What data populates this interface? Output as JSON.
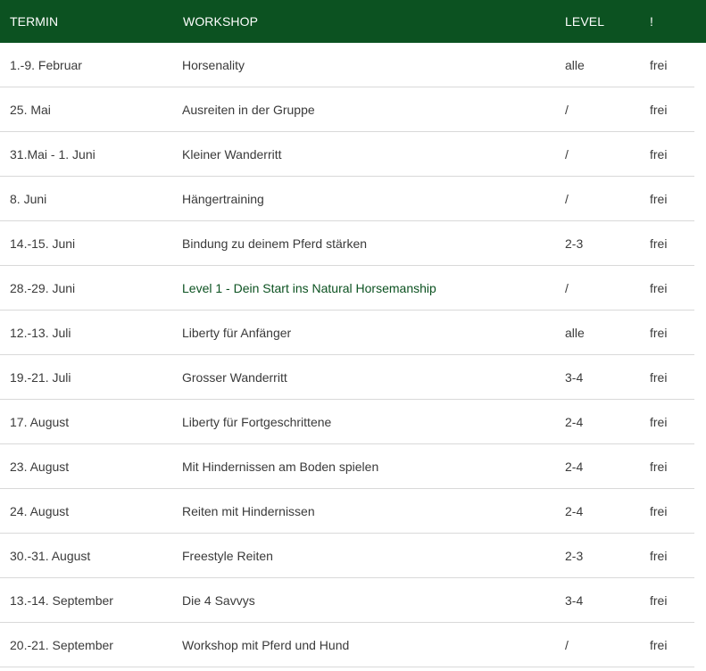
{
  "table": {
    "columns": [
      "TERMIN",
      "WORKSHOP",
      "LEVEL",
      "!"
    ],
    "rows": [
      {
        "termin": "1.-9. Februar",
        "workshop": "Horsenality",
        "level": "alle",
        "status": "frei"
      },
      {
        "termin": "25. Mai",
        "workshop": "Ausreiten in der Gruppe",
        "level": "/",
        "status": "frei"
      },
      {
        "termin": "31.Mai - 1. Juni",
        "workshop": "Kleiner Wanderritt",
        "level": "/",
        "status": "frei"
      },
      {
        "termin": "8. Juni",
        "workshop": "Hängertraining",
        "level": "/",
        "status": "frei"
      },
      {
        "termin": "14.-15. Juni",
        "workshop": "Bindung zu deinem Pferd stärken",
        "level": "2-3",
        "status": "frei"
      },
      {
        "termin": "28.-29. Juni",
        "workshop": "Level 1 - Dein Start ins Natural Horsemanship",
        "level": "/",
        "status": "frei"
      },
      {
        "termin": "12.-13. Juli",
        "workshop": "Liberty für Anfänger",
        "level": "alle",
        "status": "frei"
      },
      {
        "termin": "19.-21. Juli",
        "workshop": "Grosser Wanderritt",
        "level": "3-4",
        "status": "frei"
      },
      {
        "termin": "17. August",
        "workshop": "Liberty für Fortgeschrittene",
        "level": "2-4",
        "status": "frei"
      },
      {
        "termin": "23. August",
        "workshop": "Mit Hindernissen am Boden spielen",
        "level": "2-4",
        "status": "frei"
      },
      {
        "termin": "24. August",
        "workshop": "Reiten mit Hindernissen",
        "level": "2-4",
        "status": "frei"
      },
      {
        "termin": "30.-31. August",
        "workshop": "Freestyle Reiten",
        "level": "2-3",
        "status": "frei"
      },
      {
        "termin": "13.-14. September",
        "workshop": "Die 4 Savvys",
        "level": "3-4",
        "status": "frei"
      },
      {
        "termin": "20.-21. September",
        "workshop": "Workshop mit Pferd und Hund",
        "level": "/",
        "status": "frei"
      }
    ]
  },
  "colors": {
    "header_bg": "#0c5221",
    "header_text": "#ffffff",
    "link_text": "#0c5221",
    "body_text": "#3a3a3a",
    "row_divider": "#d9d9d9"
  }
}
